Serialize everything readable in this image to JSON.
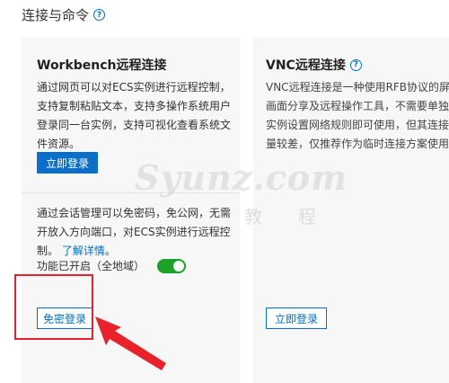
{
  "section": {
    "title": "连接与命令"
  },
  "workbench": {
    "title": "Workbench远程连接",
    "description": "通过网页可以对ECS实例进行远程控制，支持复制粘贴文本，支持多操作系统用户登录同一台实例，支持可视化查看系统文件资源。",
    "login_button": "立即登录",
    "session_text": "通过会话管理可以免密码，免公网，无需开放入方向端口，对ECS实例进行远程控制。",
    "learn_more": "了解详情",
    "learn_more_suffix": "。",
    "toggle_label": "功能已开启（全地域）",
    "toggle_on": true,
    "passwordless_button": "免密登录"
  },
  "vnc": {
    "title": "VNC远程连接",
    "description": "VNC远程连接是一种使用RFB协议的屏幕画面分享及远程操作工具，不需要单独为实例设置网络规则即可使用，但其连接质量较差，仅推荐作为临时连接方案使用。",
    "login_button": "立即登录"
  },
  "watermark": {
    "text": "Syunz.com",
    "sub": "教程"
  },
  "colors": {
    "accent": "#0070cc",
    "toggle_on": "#1aa328",
    "annotation": "#e8212a"
  },
  "icons": {
    "help": "question-circle-icon"
  }
}
